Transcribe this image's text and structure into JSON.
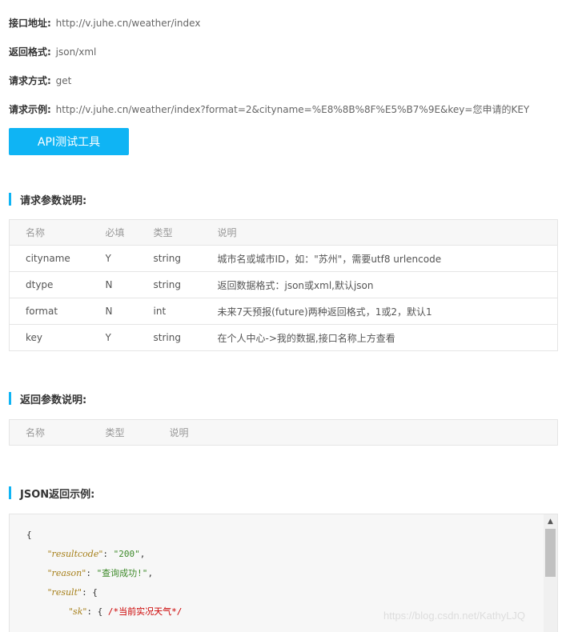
{
  "info": {
    "url": {
      "label": "接口地址:",
      "value": "http://v.juhe.cn/weather/index"
    },
    "format": {
      "label": "返回格式:",
      "value": "json/xml"
    },
    "method": {
      "label": "请求方式:",
      "value": "get"
    },
    "example": {
      "label": "请求示例:",
      "value": "http://v.juhe.cn/weather/index?format=2&cityname=%E8%8B%8F%E5%B7%9E&key=您申请的KEY"
    }
  },
  "api_button": "API测试工具",
  "request_params": {
    "title": "请求参数说明:",
    "headers": [
      "名称",
      "必填",
      "类型",
      "说明"
    ],
    "rows": [
      [
        "cityname",
        "Y",
        "string",
        "城市名或城市ID，如：\"苏州\"，需要utf8 urlencode"
      ],
      [
        "dtype",
        "N",
        "string",
        "返回数据格式：json或xml,默认json"
      ],
      [
        "format",
        "N",
        "int",
        "未来7天预报(future)两种返回格式，1或2，默认1"
      ],
      [
        "key",
        "Y",
        "string",
        "在个人中心->我的数据,接口名称上方查看"
      ]
    ]
  },
  "response_params": {
    "title": "返回参数说明:",
    "headers": [
      "名称",
      "类型",
      "说明"
    ]
  },
  "json_example": {
    "title": "JSON返回示例:",
    "lines": {
      "l0": "{",
      "l1_key": "\"resultcode\"",
      "l1_val": "\"200\"",
      "l2_key": "\"reason\"",
      "l2_val": "\"查询成功!\"",
      "l3_key": "\"result\"",
      "l4_key": "\"sk\"",
      "l4_comment": "/*当前实况天气*/"
    }
  },
  "watermark": "https://blog.csdn.net/KathyLJQ"
}
